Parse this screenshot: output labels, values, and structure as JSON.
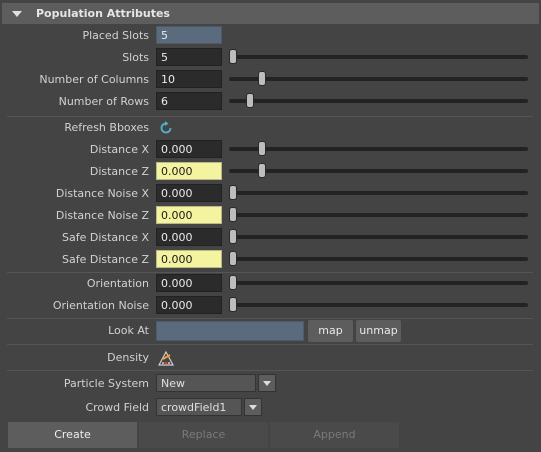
{
  "section": {
    "title": "Population Attributes"
  },
  "placed_slots": {
    "label": "Placed Slots",
    "value": "5"
  },
  "slots": {
    "label": "Slots",
    "value": "5",
    "slider_fraction": 0.0
  },
  "num_columns": {
    "label": "Number of Columns",
    "value": "10",
    "slider_fraction": 0.1
  },
  "num_rows": {
    "label": "Number of Rows",
    "value": "6",
    "slider_fraction": 0.06
  },
  "refresh": {
    "label": "Refresh Bboxes",
    "icon": "refresh-icon"
  },
  "distance_x": {
    "label": "Distance X",
    "value": "0.000",
    "slider_fraction": 0.1
  },
  "distance_z": {
    "label": "Distance Z",
    "value": "0.000",
    "slider_fraction": 0.1
  },
  "distance_noise_x": {
    "label": "Distance Noise X",
    "value": "0.000",
    "slider_fraction": 0.0
  },
  "distance_noise_z": {
    "label": "Distance Noise Z",
    "value": "0.000",
    "slider_fraction": 0.0
  },
  "safe_distance_x": {
    "label": "Safe Distance X",
    "value": "0.000",
    "slider_fraction": 0.0
  },
  "safe_distance_z": {
    "label": "Safe Distance Z",
    "value": "0.000",
    "slider_fraction": 0.0
  },
  "orientation": {
    "label": "Orientation",
    "value": "0.000",
    "slider_fraction": 0.0
  },
  "orientation_noise": {
    "label": "Orientation Noise",
    "value": "0.000",
    "slider_fraction": 0.0
  },
  "look_at": {
    "label": "Look At",
    "value": "",
    "map_label": "map",
    "unmap_label": "unmap"
  },
  "density": {
    "label": "Density",
    "icon": "paint-brush-icon"
  },
  "particle_system": {
    "label": "Particle System",
    "value": "New"
  },
  "crowd_field": {
    "label": "Crowd Field",
    "value": "crowdField1"
  },
  "actions": {
    "create": "Create",
    "replace": "Replace",
    "append": "Append"
  },
  "colors": {
    "keyed_field": "#f4f4a0",
    "connected_field": "#5a6b7e",
    "panel_bg": "#444444"
  }
}
